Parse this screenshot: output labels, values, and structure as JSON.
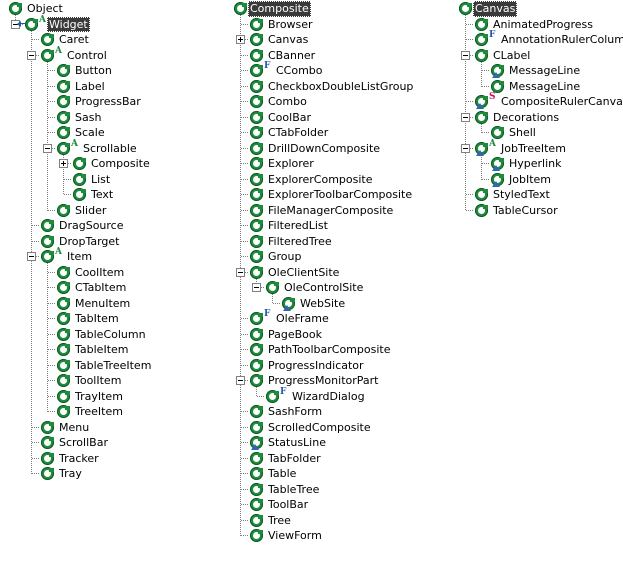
{
  "view": {
    "name": "type-hierarchy-view",
    "title": "Type Hierarchy",
    "columns": 3
  },
  "colors": {
    "class_icon": "#1f8a3b",
    "abstract_marker": "#1f8a3b",
    "final_marker": "#2457a8",
    "static_marker": "#c2185b",
    "focus_marker": "#2f66b5",
    "selection_background": "#3a3a3a",
    "selection_text": "#ffffff",
    "tree_line": "#808080",
    "background": "#ffffff"
  },
  "icons": {
    "class": "class-icon",
    "expand_collapse_minus": "collapse-minus-icon",
    "expand_collapse_plus": "expand-plus-icon",
    "override_arrow": "override-arrow-icon",
    "focus_triangle": "focus-triangle-icon",
    "abstract_letter": "A",
    "final_letter": "F",
    "static_letter": "S"
  },
  "columns": [
    {
      "id": "column-object-widget",
      "rows": [
        {
          "label": "Object",
          "depth": 0,
          "toggle": "none",
          "mods": [],
          "arrow": false,
          "tri": false,
          "selected": false
        },
        {
          "label": "Widget",
          "depth": 1,
          "toggle": "minus",
          "mods": [
            "A"
          ],
          "arrow": true,
          "tri": false,
          "selected": true
        },
        {
          "label": "Caret",
          "depth": 2,
          "toggle": "none",
          "mods": [],
          "arrow": false,
          "tri": false,
          "selected": false
        },
        {
          "label": "Control",
          "depth": 2,
          "toggle": "minus",
          "mods": [
            "A"
          ],
          "arrow": false,
          "tri": false,
          "selected": false
        },
        {
          "label": "Button",
          "depth": 3,
          "toggle": "none",
          "mods": [],
          "arrow": false,
          "tri": false,
          "selected": false
        },
        {
          "label": "Label",
          "depth": 3,
          "toggle": "none",
          "mods": [],
          "arrow": false,
          "tri": false,
          "selected": false
        },
        {
          "label": "ProgressBar",
          "depth": 3,
          "toggle": "none",
          "mods": [],
          "arrow": false,
          "tri": false,
          "selected": false
        },
        {
          "label": "Sash",
          "depth": 3,
          "toggle": "none",
          "mods": [],
          "arrow": false,
          "tri": false,
          "selected": false
        },
        {
          "label": "Scale",
          "depth": 3,
          "toggle": "none",
          "mods": [],
          "arrow": false,
          "tri": false,
          "selected": false
        },
        {
          "label": "Scrollable",
          "depth": 3,
          "toggle": "minus",
          "mods": [
            "A"
          ],
          "arrow": false,
          "tri": false,
          "selected": false
        },
        {
          "label": "Composite",
          "depth": 4,
          "toggle": "plus",
          "mods": [],
          "arrow": false,
          "tri": false,
          "selected": false
        },
        {
          "label": "List",
          "depth": 4,
          "toggle": "none",
          "mods": [],
          "arrow": false,
          "tri": false,
          "selected": false
        },
        {
          "label": "Text",
          "depth": 4,
          "toggle": "none",
          "mods": [],
          "arrow": false,
          "tri": false,
          "selected": false
        },
        {
          "label": "Slider",
          "depth": 3,
          "toggle": "none",
          "mods": [],
          "arrow": false,
          "tri": false,
          "selected": false
        },
        {
          "label": "DragSource",
          "depth": 2,
          "toggle": "none",
          "mods": [],
          "arrow": false,
          "tri": false,
          "selected": false
        },
        {
          "label": "DropTarget",
          "depth": 2,
          "toggle": "none",
          "mods": [],
          "arrow": false,
          "tri": false,
          "selected": false
        },
        {
          "label": "Item",
          "depth": 2,
          "toggle": "minus",
          "mods": [
            "A"
          ],
          "arrow": false,
          "tri": false,
          "selected": false
        },
        {
          "label": "CoolItem",
          "depth": 3,
          "toggle": "none",
          "mods": [],
          "arrow": false,
          "tri": false,
          "selected": false
        },
        {
          "label": "CTabItem",
          "depth": 3,
          "toggle": "none",
          "mods": [],
          "arrow": false,
          "tri": false,
          "selected": false
        },
        {
          "label": "MenuItem",
          "depth": 3,
          "toggle": "none",
          "mods": [],
          "arrow": false,
          "tri": false,
          "selected": false
        },
        {
          "label": "TabItem",
          "depth": 3,
          "toggle": "none",
          "mods": [],
          "arrow": false,
          "tri": false,
          "selected": false
        },
        {
          "label": "TableColumn",
          "depth": 3,
          "toggle": "none",
          "mods": [],
          "arrow": false,
          "tri": false,
          "selected": false
        },
        {
          "label": "TableItem",
          "depth": 3,
          "toggle": "none",
          "mods": [],
          "arrow": false,
          "tri": false,
          "selected": false
        },
        {
          "label": "TableTreeItem",
          "depth": 3,
          "toggle": "none",
          "mods": [],
          "arrow": false,
          "tri": false,
          "selected": false
        },
        {
          "label": "ToolItem",
          "depth": 3,
          "toggle": "none",
          "mods": [],
          "arrow": false,
          "tri": false,
          "selected": false
        },
        {
          "label": "TrayItem",
          "depth": 3,
          "toggle": "none",
          "mods": [],
          "arrow": false,
          "tri": false,
          "selected": false
        },
        {
          "label": "TreeItem",
          "depth": 3,
          "toggle": "none",
          "mods": [],
          "arrow": false,
          "tri": false,
          "selected": false
        },
        {
          "label": "Menu",
          "depth": 2,
          "toggle": "none",
          "mods": [],
          "arrow": false,
          "tri": false,
          "selected": false
        },
        {
          "label": "ScrollBar",
          "depth": 2,
          "toggle": "none",
          "mods": [],
          "arrow": false,
          "tri": false,
          "selected": false
        },
        {
          "label": "Tracker",
          "depth": 2,
          "toggle": "none",
          "mods": [],
          "arrow": false,
          "tri": false,
          "selected": false
        },
        {
          "label": "Tray",
          "depth": 2,
          "toggle": "none",
          "mods": [],
          "arrow": false,
          "tri": false,
          "selected": false
        }
      ]
    },
    {
      "id": "column-composite",
      "rows": [
        {
          "label": "Composite",
          "depth": 0,
          "toggle": "none",
          "mods": [],
          "arrow": false,
          "tri": false,
          "selected": true
        },
        {
          "label": "Browser",
          "depth": 1,
          "toggle": "none",
          "mods": [],
          "arrow": false,
          "tri": false,
          "selected": false
        },
        {
          "label": "Canvas",
          "depth": 1,
          "toggle": "plus",
          "mods": [],
          "arrow": false,
          "tri": false,
          "selected": false
        },
        {
          "label": "CBanner",
          "depth": 1,
          "toggle": "none",
          "mods": [],
          "arrow": false,
          "tri": false,
          "selected": false
        },
        {
          "label": "CCombo",
          "depth": 1,
          "toggle": "none",
          "mods": [
            "F"
          ],
          "arrow": false,
          "tri": false,
          "selected": false
        },
        {
          "label": "CheckboxDoubleListGroup",
          "depth": 1,
          "toggle": "none",
          "mods": [],
          "arrow": false,
          "tri": false,
          "selected": false
        },
        {
          "label": "Combo",
          "depth": 1,
          "toggle": "none",
          "mods": [],
          "arrow": false,
          "tri": false,
          "selected": false
        },
        {
          "label": "CoolBar",
          "depth": 1,
          "toggle": "none",
          "mods": [],
          "arrow": false,
          "tri": false,
          "selected": false
        },
        {
          "label": "CTabFolder",
          "depth": 1,
          "toggle": "none",
          "mods": [],
          "arrow": false,
          "tri": false,
          "selected": false
        },
        {
          "label": "DrillDownComposite",
          "depth": 1,
          "toggle": "none",
          "mods": [],
          "arrow": false,
          "tri": false,
          "selected": false
        },
        {
          "label": "Explorer",
          "depth": 1,
          "toggle": "none",
          "mods": [],
          "arrow": false,
          "tri": false,
          "selected": false
        },
        {
          "label": "ExplorerComposite",
          "depth": 1,
          "toggle": "none",
          "mods": [],
          "arrow": false,
          "tri": false,
          "selected": false
        },
        {
          "label": "ExplorerToolbarComposite",
          "depth": 1,
          "toggle": "none",
          "mods": [],
          "arrow": false,
          "tri": false,
          "selected": false
        },
        {
          "label": "FileManagerComposite",
          "depth": 1,
          "toggle": "none",
          "mods": [],
          "arrow": false,
          "tri": false,
          "selected": false
        },
        {
          "label": "FilteredList",
          "depth": 1,
          "toggle": "none",
          "mods": [],
          "arrow": false,
          "tri": false,
          "selected": false
        },
        {
          "label": "FilteredTree",
          "depth": 1,
          "toggle": "none",
          "mods": [],
          "arrow": false,
          "tri": false,
          "selected": false
        },
        {
          "label": "Group",
          "depth": 1,
          "toggle": "none",
          "mods": [],
          "arrow": false,
          "tri": false,
          "selected": false
        },
        {
          "label": "OleClientSite",
          "depth": 1,
          "toggle": "minus",
          "mods": [],
          "arrow": false,
          "tri": false,
          "selected": false
        },
        {
          "label": "OleControlSite",
          "depth": 2,
          "toggle": "minus",
          "mods": [],
          "arrow": false,
          "tri": false,
          "selected": false
        },
        {
          "label": "WebSite",
          "depth": 3,
          "toggle": "none",
          "mods": [],
          "arrow": false,
          "tri": true,
          "selected": false
        },
        {
          "label": "OleFrame",
          "depth": 1,
          "toggle": "none",
          "mods": [
            "F"
          ],
          "arrow": false,
          "tri": false,
          "selected": false
        },
        {
          "label": "PageBook",
          "depth": 1,
          "toggle": "none",
          "mods": [],
          "arrow": false,
          "tri": false,
          "selected": false
        },
        {
          "label": "PathToolbarComposite",
          "depth": 1,
          "toggle": "none",
          "mods": [],
          "arrow": false,
          "tri": false,
          "selected": false
        },
        {
          "label": "ProgressIndicator",
          "depth": 1,
          "toggle": "none",
          "mods": [],
          "arrow": false,
          "tri": false,
          "selected": false
        },
        {
          "label": "ProgressMonitorPart",
          "depth": 1,
          "toggle": "minus",
          "mods": [],
          "arrow": false,
          "tri": false,
          "selected": false
        },
        {
          "label": "WizardDialog",
          "depth": 2,
          "toggle": "none",
          "mods": [
            "F"
          ],
          "arrow": false,
          "tri": false,
          "selected": false
        },
        {
          "label": "SashForm",
          "depth": 1,
          "toggle": "none",
          "mods": [],
          "arrow": false,
          "tri": false,
          "selected": false
        },
        {
          "label": "ScrolledComposite",
          "depth": 1,
          "toggle": "none",
          "mods": [],
          "arrow": false,
          "tri": false,
          "selected": false
        },
        {
          "label": "StatusLine",
          "depth": 1,
          "toggle": "none",
          "mods": [],
          "arrow": false,
          "tri": true,
          "selected": false
        },
        {
          "label": "TabFolder",
          "depth": 1,
          "toggle": "none",
          "mods": [],
          "arrow": false,
          "tri": false,
          "selected": false
        },
        {
          "label": "Table",
          "depth": 1,
          "toggle": "none",
          "mods": [],
          "arrow": false,
          "tri": false,
          "selected": false
        },
        {
          "label": "TableTree",
          "depth": 1,
          "toggle": "none",
          "mods": [],
          "arrow": false,
          "tri": false,
          "selected": false
        },
        {
          "label": "ToolBar",
          "depth": 1,
          "toggle": "none",
          "mods": [],
          "arrow": false,
          "tri": false,
          "selected": false
        },
        {
          "label": "Tree",
          "depth": 1,
          "toggle": "none",
          "mods": [],
          "arrow": false,
          "tri": false,
          "selected": false
        },
        {
          "label": "ViewForm",
          "depth": 1,
          "toggle": "none",
          "mods": [],
          "arrow": false,
          "tri": false,
          "selected": false
        }
      ]
    },
    {
      "id": "column-canvas",
      "rows": [
        {
          "label": "Canvas",
          "depth": 0,
          "toggle": "none",
          "mods": [],
          "arrow": false,
          "tri": false,
          "selected": true
        },
        {
          "label": "AnimatedProgress",
          "depth": 1,
          "toggle": "none",
          "mods": [],
          "arrow": false,
          "tri": false,
          "selected": false
        },
        {
          "label": "AnnotationRulerColumn",
          "depth": 1,
          "toggle": "none",
          "mods": [
            "F"
          ],
          "arrow": false,
          "tri": false,
          "selected": false
        },
        {
          "label": "CLabel",
          "depth": 1,
          "toggle": "minus",
          "mods": [],
          "arrow": false,
          "tri": false,
          "selected": false
        },
        {
          "label": "MessageLine",
          "depth": 2,
          "toggle": "none",
          "mods": [],
          "arrow": false,
          "tri": true,
          "selected": false
        },
        {
          "label": "MessageLine",
          "depth": 2,
          "toggle": "none",
          "mods": [],
          "arrow": false,
          "tri": false,
          "selected": false
        },
        {
          "label": "CompositeRulerCanvas",
          "depth": 1,
          "toggle": "none",
          "mods": [
            "S"
          ],
          "arrow": false,
          "tri": true,
          "selected": false
        },
        {
          "label": "Decorations",
          "depth": 1,
          "toggle": "minus",
          "mods": [],
          "arrow": false,
          "tri": false,
          "selected": false
        },
        {
          "label": "Shell",
          "depth": 2,
          "toggle": "none",
          "mods": [],
          "arrow": false,
          "tri": false,
          "selected": false
        },
        {
          "label": "JobTreeItem",
          "depth": 1,
          "toggle": "minus",
          "mods": [
            "A"
          ],
          "arrow": false,
          "tri": true,
          "selected": false
        },
        {
          "label": "Hyperlink",
          "depth": 2,
          "toggle": "none",
          "mods": [],
          "arrow": false,
          "tri": true,
          "selected": false
        },
        {
          "label": "JobItem",
          "depth": 2,
          "toggle": "none",
          "mods": [],
          "arrow": false,
          "tri": true,
          "selected": false
        },
        {
          "label": "StyledText",
          "depth": 1,
          "toggle": "none",
          "mods": [],
          "arrow": false,
          "tri": false,
          "selected": false
        },
        {
          "label": "TableCursor",
          "depth": 1,
          "toggle": "none",
          "mods": [],
          "arrow": false,
          "tri": false,
          "selected": false
        }
      ]
    }
  ]
}
